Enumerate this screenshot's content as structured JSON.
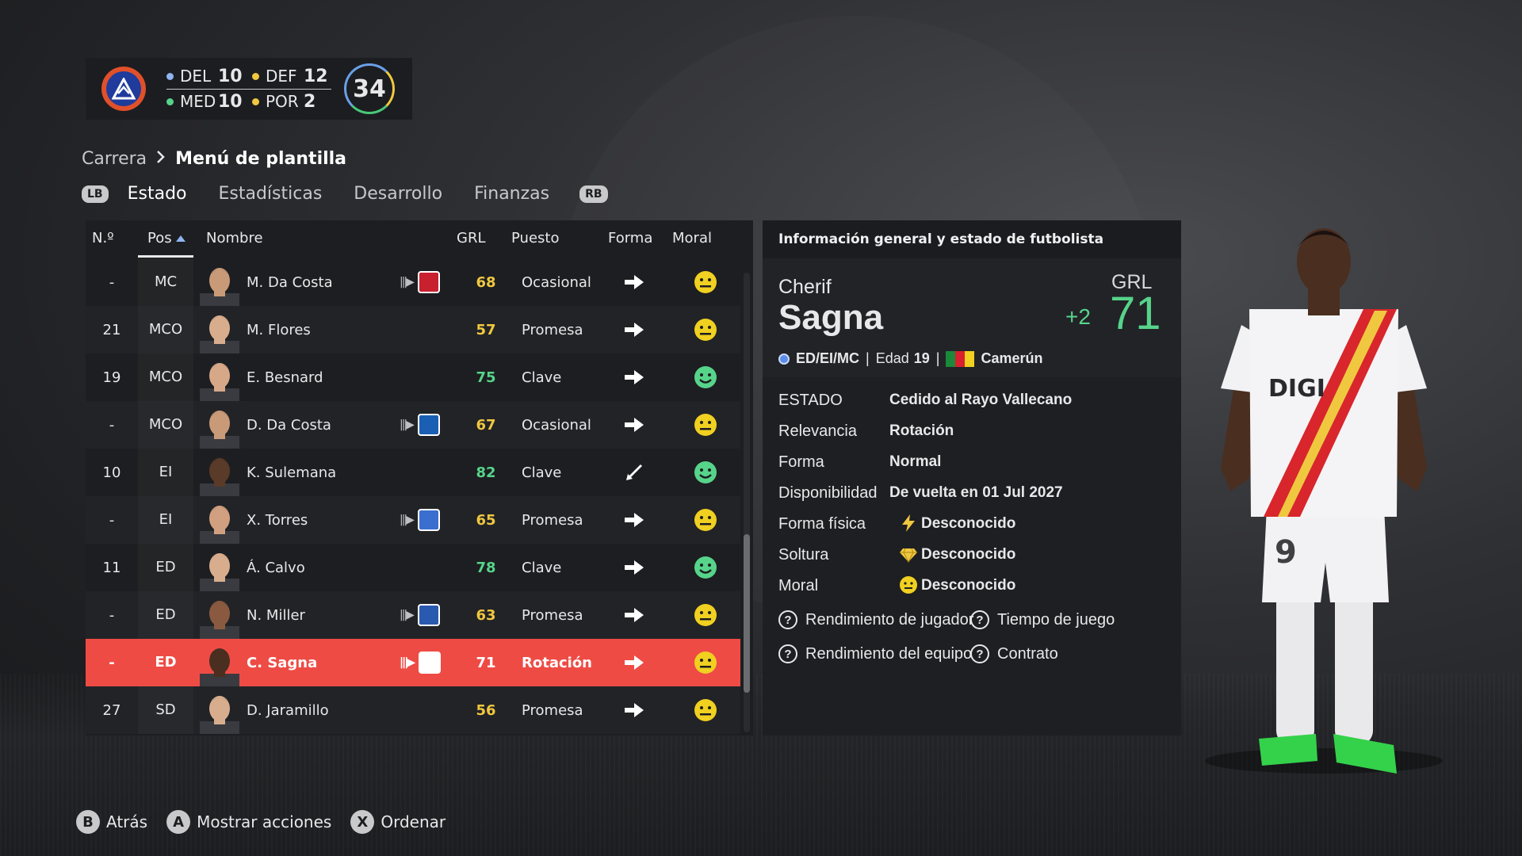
{
  "summary": {
    "counts": [
      {
        "label": "DEL",
        "value": "10",
        "color": "#8fb4f0"
      },
      {
        "label": "DEF",
        "value": "12",
        "color": "#f0c840"
      },
      {
        "label": "MED",
        "value": "10",
        "color": "#56d48a"
      },
      {
        "label": "POR",
        "value": "2",
        "color": "#f0c840"
      }
    ],
    "total": "34"
  },
  "breadcrumb": {
    "parent": "Carrera",
    "current": "Menú de plantilla"
  },
  "tabs": {
    "lb": "LB",
    "rb": "RB",
    "items": [
      "Estado",
      "Estadísticas",
      "Desarrollo",
      "Finanzas"
    ]
  },
  "table": {
    "headers": {
      "no": "N.º",
      "pos": "Pos",
      "name": "Nombre",
      "grl": "GRL",
      "role": "Puesto",
      "form": "Forma",
      "moral": "Moral"
    },
    "rows": [
      {
        "no": "-",
        "pos": "MC",
        "name": "M. Da Costa",
        "loan": true,
        "club_color": "#c8202e",
        "grl": "68",
        "grl_color": "#f0c840",
        "role": "Ocasional",
        "form": "right-arrow-icon",
        "moral": "neutral",
        "skin": "#c99a78",
        "hair": "#3a2a20"
      },
      {
        "no": "21",
        "pos": "MCO",
        "name": "M. Flores",
        "loan": false,
        "grl": "57",
        "grl_color": "#f0c840",
        "role": "Promesa",
        "form": "right-arrow-icon",
        "moral": "neutral",
        "skin": "#d8ad8e",
        "hair": "#4a3324"
      },
      {
        "no": "19",
        "pos": "MCO",
        "name": "E. Besnard",
        "loan": false,
        "grl": "75",
        "grl_color": "#56d48a",
        "role": "Clave",
        "form": "right-arrow-icon",
        "moral": "happy",
        "skin": "#d6a888",
        "hair": "#5a3d2a"
      },
      {
        "no": "-",
        "pos": "MCO",
        "name": "D. Da Costa",
        "loan": true,
        "club_color": "#1a5fb4",
        "grl": "67",
        "grl_color": "#f0c840",
        "role": "Ocasional",
        "form": "right-arrow-icon",
        "moral": "neutral",
        "skin": "#c99a78",
        "hair": "#3a2a20"
      },
      {
        "no": "10",
        "pos": "EI",
        "name": "K. Sulemana",
        "loan": false,
        "grl": "82",
        "grl_color": "#56d48a",
        "role": "Clave",
        "form": "down-left-arrow-icon",
        "moral": "happy",
        "skin": "#5a3a28",
        "hair": "#1a1210"
      },
      {
        "no": "-",
        "pos": "EI",
        "name": "X. Torres",
        "loan": true,
        "club_color": "#3a6fd0",
        "grl": "65",
        "grl_color": "#f0c840",
        "role": "Promesa",
        "form": "right-arrow-icon",
        "moral": "neutral",
        "skin": "#d0a080",
        "hair": "#2a1d16"
      },
      {
        "no": "11",
        "pos": "ED",
        "name": "Á. Calvo",
        "loan": false,
        "grl": "78",
        "grl_color": "#56d48a",
        "role": "Clave",
        "form": "right-arrow-icon",
        "moral": "happy",
        "skin": "#d8ad8e",
        "hair": "#6a4a30"
      },
      {
        "no": "-",
        "pos": "ED",
        "name": "N. Miller",
        "loan": true,
        "club_color": "#2a5ab0",
        "grl": "63",
        "grl_color": "#f0c840",
        "role": "Promesa",
        "form": "right-arrow-icon",
        "moral": "neutral",
        "skin": "#8a5a40",
        "hair": "#1a1210"
      },
      {
        "no": "-",
        "pos": "ED",
        "name": "C. Sagna",
        "loan": true,
        "club_color": "#ffffff",
        "grl": "71",
        "grl_color": "#ffffff",
        "role": "Rotación",
        "form": "right-arrow-icon",
        "moral": "neutral",
        "skin": "#4a2e20",
        "hair": "#1a1210",
        "selected": true
      },
      {
        "no": "27",
        "pos": "SD",
        "name": "D. Jaramillo",
        "loan": false,
        "grl": "56",
        "grl_color": "#f0c840",
        "role": "Promesa",
        "form": "right-arrow-icon",
        "moral": "neutral",
        "skin": "#d8ad8e",
        "hair": "#3a2a20"
      }
    ]
  },
  "info": {
    "title": "Información general y estado de futbolista",
    "first_name": "Cherif",
    "last_name": "Sagna",
    "grl_label": "GRL",
    "grl_delta": "+2",
    "grl_value": "71",
    "positions": "ED/EI/MC",
    "age_label": "Edad",
    "age": "19",
    "nationality": "Camerún",
    "rows": {
      "estado_label": "ESTADO",
      "estado_value": "Cedido al Rayo Vallecano",
      "relevancia_label": "Relevancia",
      "relevancia_value": "Rotación",
      "forma_label": "Forma",
      "forma_value": "Normal",
      "disponibilidad_label": "Disponibilidad",
      "disponibilidad_value": "De vuelta en 01 Jul 2027",
      "forma_fisica_label": "Forma física",
      "forma_fisica_value": "Desconocido",
      "soltura_label": "Soltura",
      "soltura_value": "Desconocido",
      "moral_label": "Moral",
      "moral_value": "Desconocido"
    },
    "links": [
      "Rendimiento de jugador",
      "Tiempo de juego",
      "Rendimiento del equipo",
      "Contrato"
    ]
  },
  "footer": [
    {
      "key": "B",
      "label": "Atrás"
    },
    {
      "key": "A",
      "label": "Mostrar acciones"
    },
    {
      "key": "X",
      "label": "Ordenar"
    }
  ]
}
